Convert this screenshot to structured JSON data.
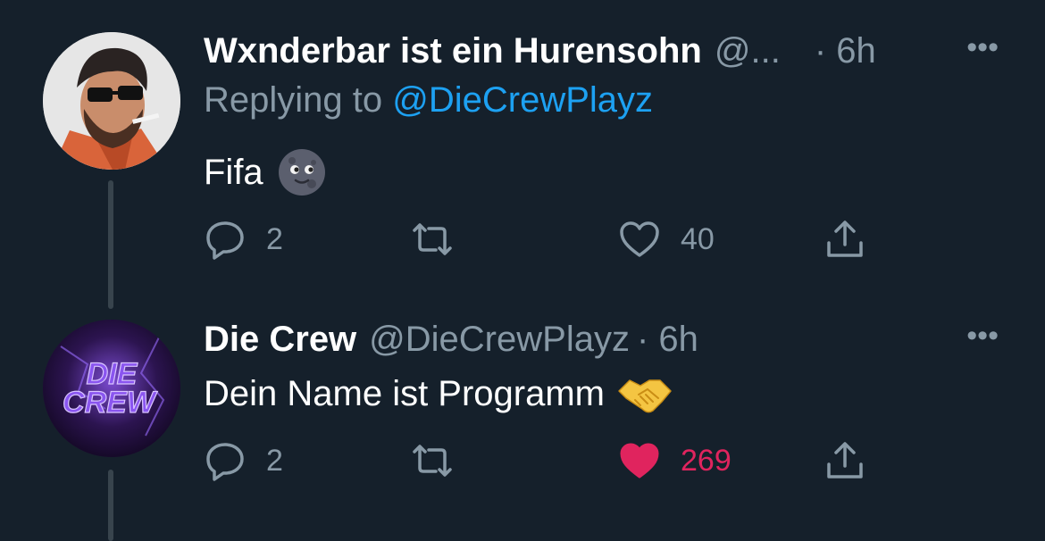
{
  "tweets": [
    {
      "name": "Wxnderbar ist ein Hurensohn",
      "handle": "@...",
      "time": "· 6h",
      "more": "•••",
      "reply_prefix": "Replying to ",
      "reply_to": "@DieCrewPlayz",
      "text": "Fifa",
      "emoji": "new-moon-face-emoji",
      "replies": "2",
      "likes": "40",
      "liked": false
    },
    {
      "name": "Die Crew",
      "handle": "@DieCrewPlayz",
      "time": "· 6h",
      "more": "•••",
      "text": "Dein Name ist Programm",
      "emoji": "handshake-emoji",
      "replies": "2",
      "likes": "269",
      "liked": true,
      "avatar_text": "DIE CREW"
    }
  ],
  "colors": {
    "background": "#15202b",
    "secondary_text": "#8899a6",
    "link": "#1da1f2",
    "like_active": "#e0245e",
    "thread_line": "#38444d"
  }
}
